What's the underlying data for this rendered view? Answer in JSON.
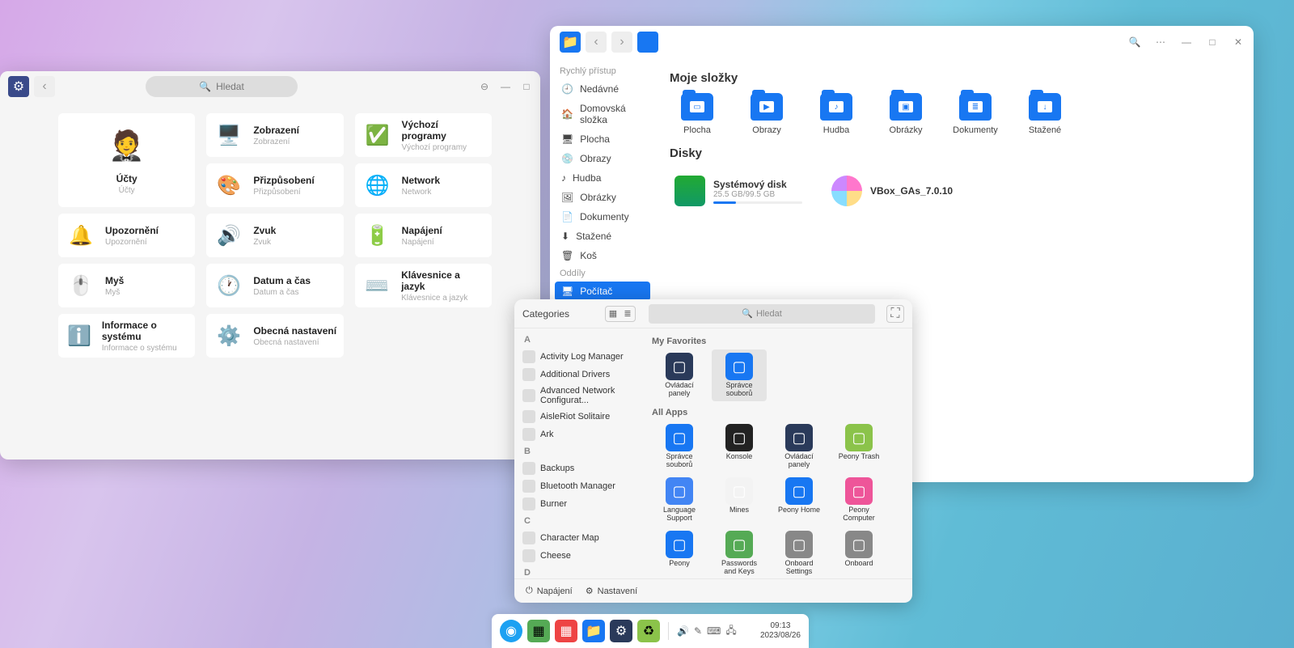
{
  "settings": {
    "search_placeholder": "Hledat",
    "cards": {
      "accounts": {
        "t": "Účty",
        "s": "Účty"
      },
      "display": {
        "t": "Zobrazení",
        "s": "Zobrazení"
      },
      "defaults": {
        "t": "Výchozí programy",
        "s": "Výchozí programy"
      },
      "personalize": {
        "t": "Přizpůsobení",
        "s": "Přizpůsobení"
      },
      "network": {
        "t": "Network",
        "s": "Network"
      },
      "notif": {
        "t": "Upozornění",
        "s": "Upozornění"
      },
      "sound": {
        "t": "Zvuk",
        "s": "Zvuk"
      },
      "power": {
        "t": "Napájení",
        "s": "Napájení"
      },
      "mouse": {
        "t": "Myš",
        "s": "Myš"
      },
      "datetime": {
        "t": "Datum a čas",
        "s": "Datum a čas"
      },
      "keyboard": {
        "t": "Klávesnice a jazyk",
        "s": "Klávesnice a jazyk"
      },
      "about": {
        "t": "Informace o systému",
        "s": "Informace o systému"
      },
      "general": {
        "t": "Obecná nastavení",
        "s": "Obecná nastavení"
      }
    }
  },
  "files": {
    "quick_header": "Rychlý přístup",
    "side": {
      "recent": "Nedávné",
      "home": "Domovská složka",
      "desktop": "Plocha",
      "pictures_img": "Obrazy",
      "music": "Hudba",
      "pictures": "Obrázky",
      "documents": "Dokumenty",
      "downloads": "Stažené",
      "trash": "Koš"
    },
    "parts_header": "Oddíly",
    "computer": "Počítač",
    "h1": "Moje složky",
    "folders": [
      {
        "l": "Plocha",
        "badge": "▭"
      },
      {
        "l": "Obrazy",
        "badge": "▶"
      },
      {
        "l": "Hudba",
        "badge": "♪"
      },
      {
        "l": "Obrázky",
        "badge": "▣"
      },
      {
        "l": "Dokumenty",
        "badge": "≣"
      },
      {
        "l": "Stažené",
        "badge": "↓"
      }
    ],
    "h2": "Disky",
    "disk1": {
      "t": "Systémový disk",
      "s": "25.5 GB/99.5 GB",
      "pct": 25.6
    },
    "disk2": {
      "t": "VBox_GAs_7.0.10"
    }
  },
  "menu": {
    "categories_label": "Categories",
    "search_placeholder": "Hledat",
    "sidebar": [
      {
        "letter": "A"
      },
      {
        "n": "Activity Log Manager"
      },
      {
        "n": "Additional Drivers"
      },
      {
        "n": "Advanced Network Configurat..."
      },
      {
        "n": "AisleRiot Solitaire"
      },
      {
        "n": "Ark"
      },
      {
        "letter": "B"
      },
      {
        "n": "Backups"
      },
      {
        "n": "Bluetooth Manager"
      },
      {
        "n": "Burner"
      },
      {
        "letter": "C"
      },
      {
        "n": "Character Map"
      },
      {
        "n": "Cheese"
      },
      {
        "letter": "D"
      }
    ],
    "fav_header": "My Favorites",
    "favorites": [
      {
        "n": "Ovládací panely",
        "c": "#2a3a5a"
      },
      {
        "n": "Správce souborů",
        "c": "#1877f2",
        "sel": true
      }
    ],
    "all_header": "All Apps",
    "all": [
      {
        "n": "Správce souborů",
        "c": "#1877f2"
      },
      {
        "n": "Konsole",
        "c": "#222"
      },
      {
        "n": "Ovládací panely",
        "c": "#2a3a5a"
      },
      {
        "n": "Peony Trash",
        "c": "#8bc34a"
      },
      {
        "n": "Language Support",
        "c": "#4285f4"
      },
      {
        "n": "Mines",
        "c": "#f3f3f3"
      },
      {
        "n": "Peony Home",
        "c": "#1877f2"
      },
      {
        "n": "Peony Computer",
        "c": "#e59"
      },
      {
        "n": "Peony",
        "c": "#1877f2"
      },
      {
        "n": "Passwords and Keys",
        "c": "#5a5"
      },
      {
        "n": "Onboard Settings",
        "c": "#888"
      },
      {
        "n": "Onboard",
        "c": "#888"
      }
    ],
    "foot": {
      "power": "Napájení",
      "settings": "Nastavení"
    }
  },
  "taskbar": {
    "time": "09:13",
    "date": "2023/08/26"
  }
}
